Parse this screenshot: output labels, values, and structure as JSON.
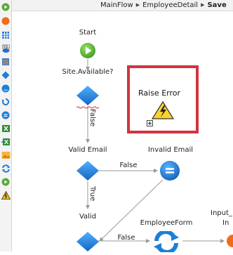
{
  "breadcrumb": {
    "items": [
      "MainFlow",
      "EmployeeDetail",
      "Save"
    ]
  },
  "toolbox": {
    "tools": [
      "start-icon",
      "end-icon",
      "aggregate-icon",
      "sql-icon",
      "data-icon",
      "if-icon",
      "if-blue-icon",
      "foreach-icon",
      "assign-icon",
      "excel-icon",
      "excel-import-icon",
      "image-icon",
      "refresh-icon",
      "destination-icon",
      "raise-error-icon"
    ]
  },
  "flow": {
    "start_label": "Start",
    "site_available_label": "Site.Available?",
    "raise_error_label": "Raise Error",
    "false_vertical": "False",
    "valid_email_label": "Valid Email",
    "invalid_email_label": "Invalid Email",
    "false_h1": "False",
    "true_vertical": "True",
    "valid_label": "Valid",
    "employee_form_label": "EmployeeForm",
    "false_h2": "False",
    "input_label": "Input_",
    "input_label2": "In"
  },
  "colors": {
    "highlight_border": "#d1343d",
    "node_blue": "#1e7fd6",
    "start_green": "#63b437"
  }
}
